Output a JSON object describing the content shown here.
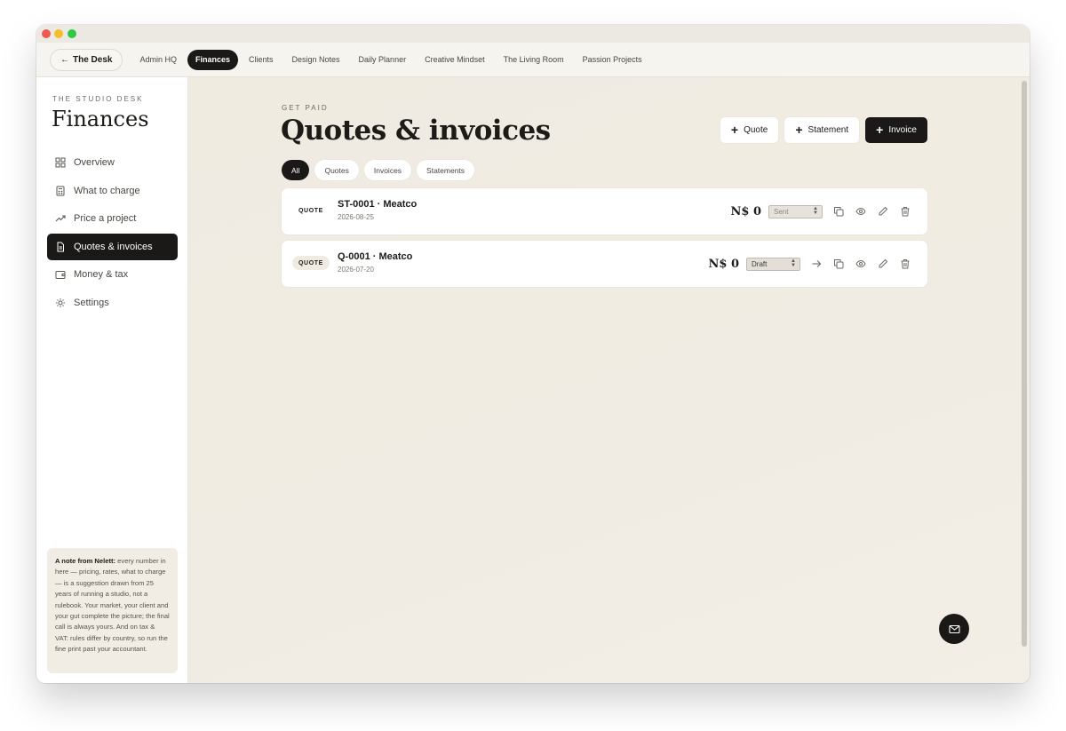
{
  "topnav": {
    "back_label": "The Desk",
    "items": [
      {
        "label": "Admin HQ"
      },
      {
        "label": "Finances"
      },
      {
        "label": "Clients"
      },
      {
        "label": "Design Notes"
      },
      {
        "label": "Daily Planner"
      },
      {
        "label": "Creative Mindset"
      },
      {
        "label": "The Living Room"
      },
      {
        "label": "Passion Projects"
      }
    ],
    "active_index": 1
  },
  "sidebar": {
    "eyebrow": "THE STUDIO DESK",
    "title": "Finances",
    "items": [
      {
        "label": "Overview",
        "icon": "grid-icon"
      },
      {
        "label": "What to charge",
        "icon": "calculator-icon"
      },
      {
        "label": "Price a project",
        "icon": "trend-icon"
      },
      {
        "label": "Quotes & invoices",
        "icon": "document-icon"
      },
      {
        "label": "Money & tax",
        "icon": "wallet-icon"
      },
      {
        "label": "Settings",
        "icon": "gear-icon"
      }
    ],
    "active_index": 3,
    "note": {
      "lead": "A note from Nelett:",
      "body": " every number in here — pricing, rates, what to charge — is a suggestion drawn from 25 years of running a studio, not a rulebook. Your market, your client and your gut complete the picture; the final call is always yours. And on tax & VAT: rules differ by country, so run the fine print past your accountant."
    }
  },
  "main": {
    "kicker": "GET PAID",
    "title": "Quotes & invoices",
    "actions": {
      "quote": "Quote",
      "statement": "Statement",
      "invoice": "Invoice"
    },
    "filters": [
      "All",
      "Quotes",
      "Invoices",
      "Statements"
    ],
    "active_filter": "All",
    "documents": [
      {
        "type": "QUOTE",
        "title": "ST-0001 · Meatco",
        "date": "2026-08-25",
        "amount": "N$ 0",
        "status": "Sent"
      },
      {
        "type": "QUOTE",
        "title": "Q-0001 · Meatco",
        "date": "2026-07-20",
        "amount": "N$ 0",
        "status": "Draft"
      }
    ]
  },
  "colors": {
    "accent": "#1a1917",
    "background": "#f0ece3",
    "card": "#ffffff"
  }
}
